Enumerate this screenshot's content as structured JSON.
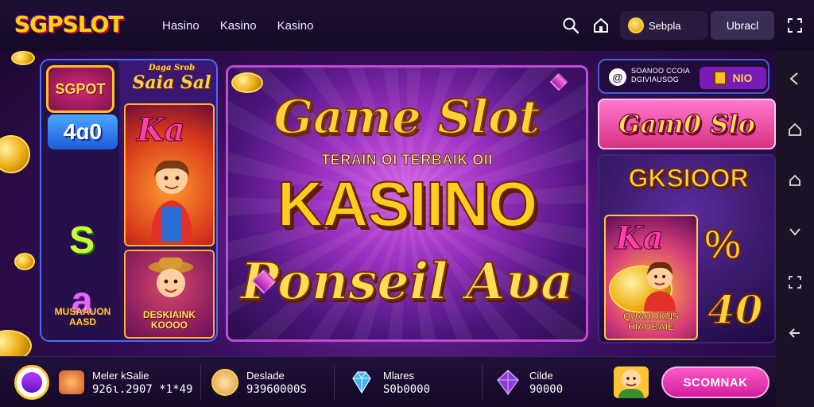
{
  "header": {
    "logo": "SGPSLOT",
    "nav": [
      "Hasino",
      "Kasino",
      "Kasino"
    ],
    "coin_label": "Sebpla",
    "upload_label": "Ubracl"
  },
  "left_panel": {
    "logo_text": "SGPOT",
    "badge_text": "4ɑ0",
    "tile_green": "S",
    "tile_purple": "a",
    "shield_text": "MUSAAUON AASD",
    "title_small": "Daga Srob",
    "title_big": "Saia Sal",
    "card_ka": "Ka",
    "card_two_text": "DESKIAINK KOOOO"
  },
  "center_panel": {
    "line1": "Game Slot",
    "line2": "TERAIN OI TERBAIK OII",
    "line3": "KASIINO",
    "line4": "Ponseil Aʋa"
  },
  "right_panel": {
    "header_line1": "SOANOO CCOIA",
    "header_line2": "DGIVIAUSOG",
    "header_btn": "NIO",
    "banner1": "Gam0 Slo",
    "title": "GKSIOOR",
    "ka": "Ka",
    "ka_caption": "QUAHOKNS HIAUBAIE",
    "pct": "%",
    "forty": "40"
  },
  "bottom": {
    "stats": [
      {
        "label": "Meler kSalie",
        "value": "926ɩ.2907 *1*49"
      },
      {
        "label": "Deslade",
        "value": "93960000S"
      },
      {
        "label": "Mlares",
        "value": "S0b0000"
      },
      {
        "label": "Cilde",
        "value": "90000"
      }
    ],
    "cta": "SCOMNAK"
  },
  "colors": {
    "brand_gold": "#ffd23a",
    "brand_pink": "#ff2c8e",
    "accent_purple": "#7a1ab8"
  }
}
